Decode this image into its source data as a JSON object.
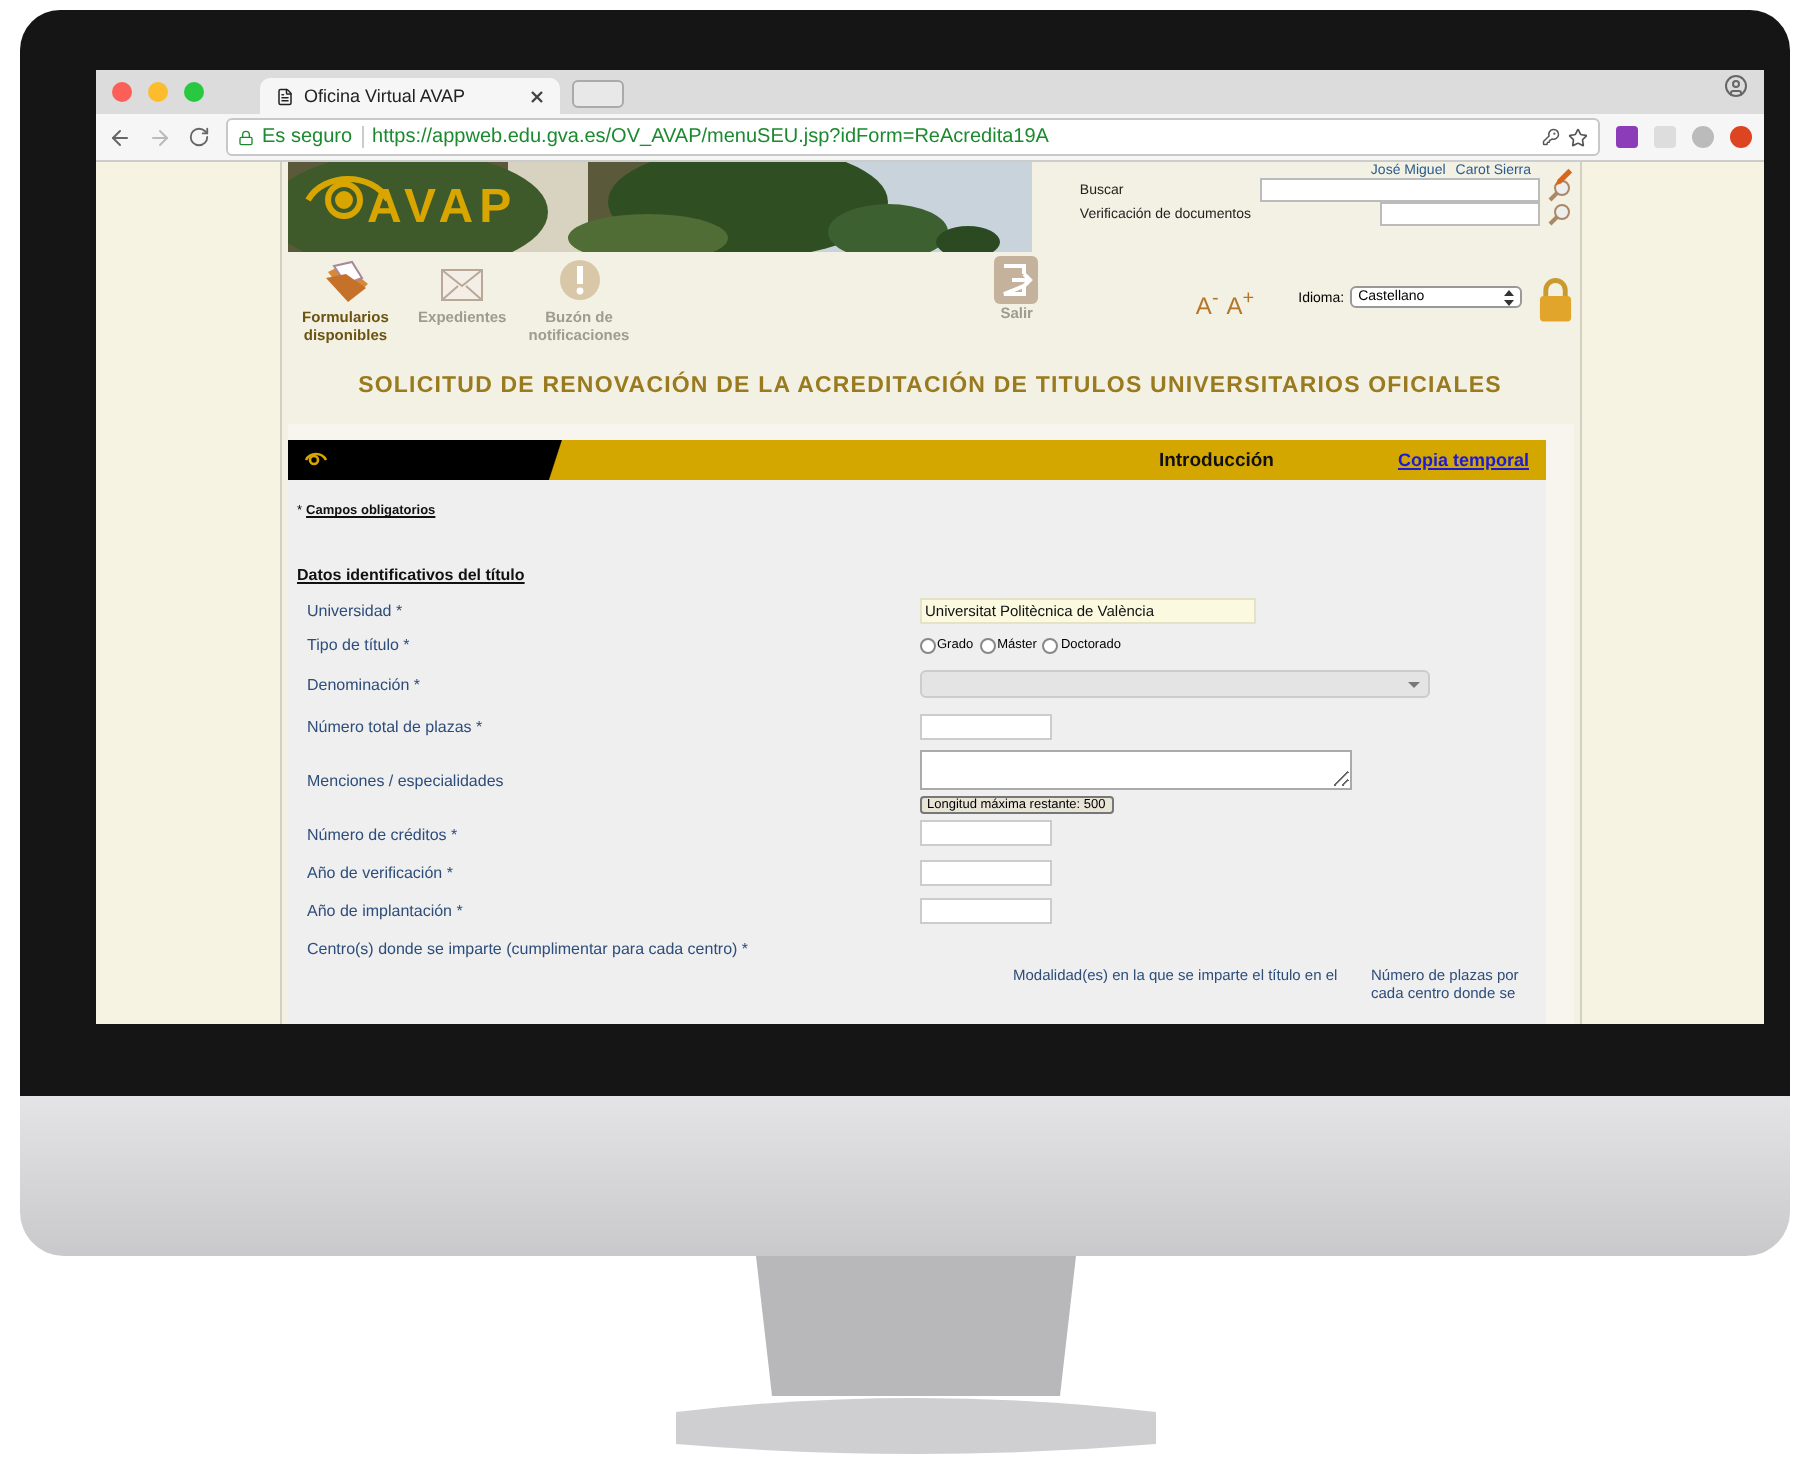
{
  "browser": {
    "tab_title": "Oficina Virtual AVAP",
    "secure_label": "Es seguro",
    "url": "https://appweb.edu.gva.es/OV_AVAP/menuSEU.jsp?idForm=ReAcredita19A"
  },
  "header": {
    "logo_text": "AVAP",
    "user_first": "José Miguel",
    "user_last": "Carot Sierra",
    "search_label": "Buscar",
    "verify_label": "Verificación de documentos",
    "nav": [
      {
        "label": "Formularios disponibles",
        "kind": "forms",
        "selected": true
      },
      {
        "label": "Expedientes",
        "kind": "files",
        "selected": false
      },
      {
        "label": "Buzón de notificaciones",
        "kind": "alerts",
        "selected": false
      }
    ],
    "exit": "Salir",
    "font_smaller": "A$^{-}$",
    "font_larger": "A$^{+}$",
    "language_label": "Idioma:",
    "language": "Castellano"
  },
  "page_title": "SOLICITUD DE RENOVACIÓN DE LA ACREDITACIÓN DE TITULOS UNIVERSITARIOS OFICIALES",
  "section_bar": {
    "title": "Introducción",
    "link": "Copia temporal"
  },
  "required_mark": "*",
  "required_note": "Campos obligatorios",
  "section_heading": "Datos identificativos del título",
  "fields": [
    {
      "label": "Universidad *",
      "kind": "readonly",
      "value": "Universitat Politècnica de València"
    },
    {
      "label": "Tipo de título *",
      "kind": "radio",
      "options": [
        {
          "label": "Grado",
          "selected": false
        },
        {
          "label": "Máster",
          "selected": false
        },
        {
          "label": "Doctorado",
          "selected": false
        }
      ]
    },
    {
      "label": "Denominación *",
      "kind": "select",
      "disabled": true
    },
    {
      "label": "Número total de plazas *",
      "kind": "input"
    },
    {
      "label": "Menciones / especialidades",
      "kind": "textarea",
      "counter": "Longitud máxima restante: 500"
    },
    {
      "label": "Número de créditos *",
      "kind": "input"
    },
    {
      "label": "Año de verificación *",
      "kind": "input"
    },
    {
      "label": "Año de implantación *",
      "kind": "input"
    }
  ],
  "centers_label": "Centro(s) donde se imparte (cumplimentar para cada centro) *",
  "centers_columns": [
    "Modalidad(es) en la que se imparte el título en el",
    "Número de plazas por cada centro donde se"
  ]
}
